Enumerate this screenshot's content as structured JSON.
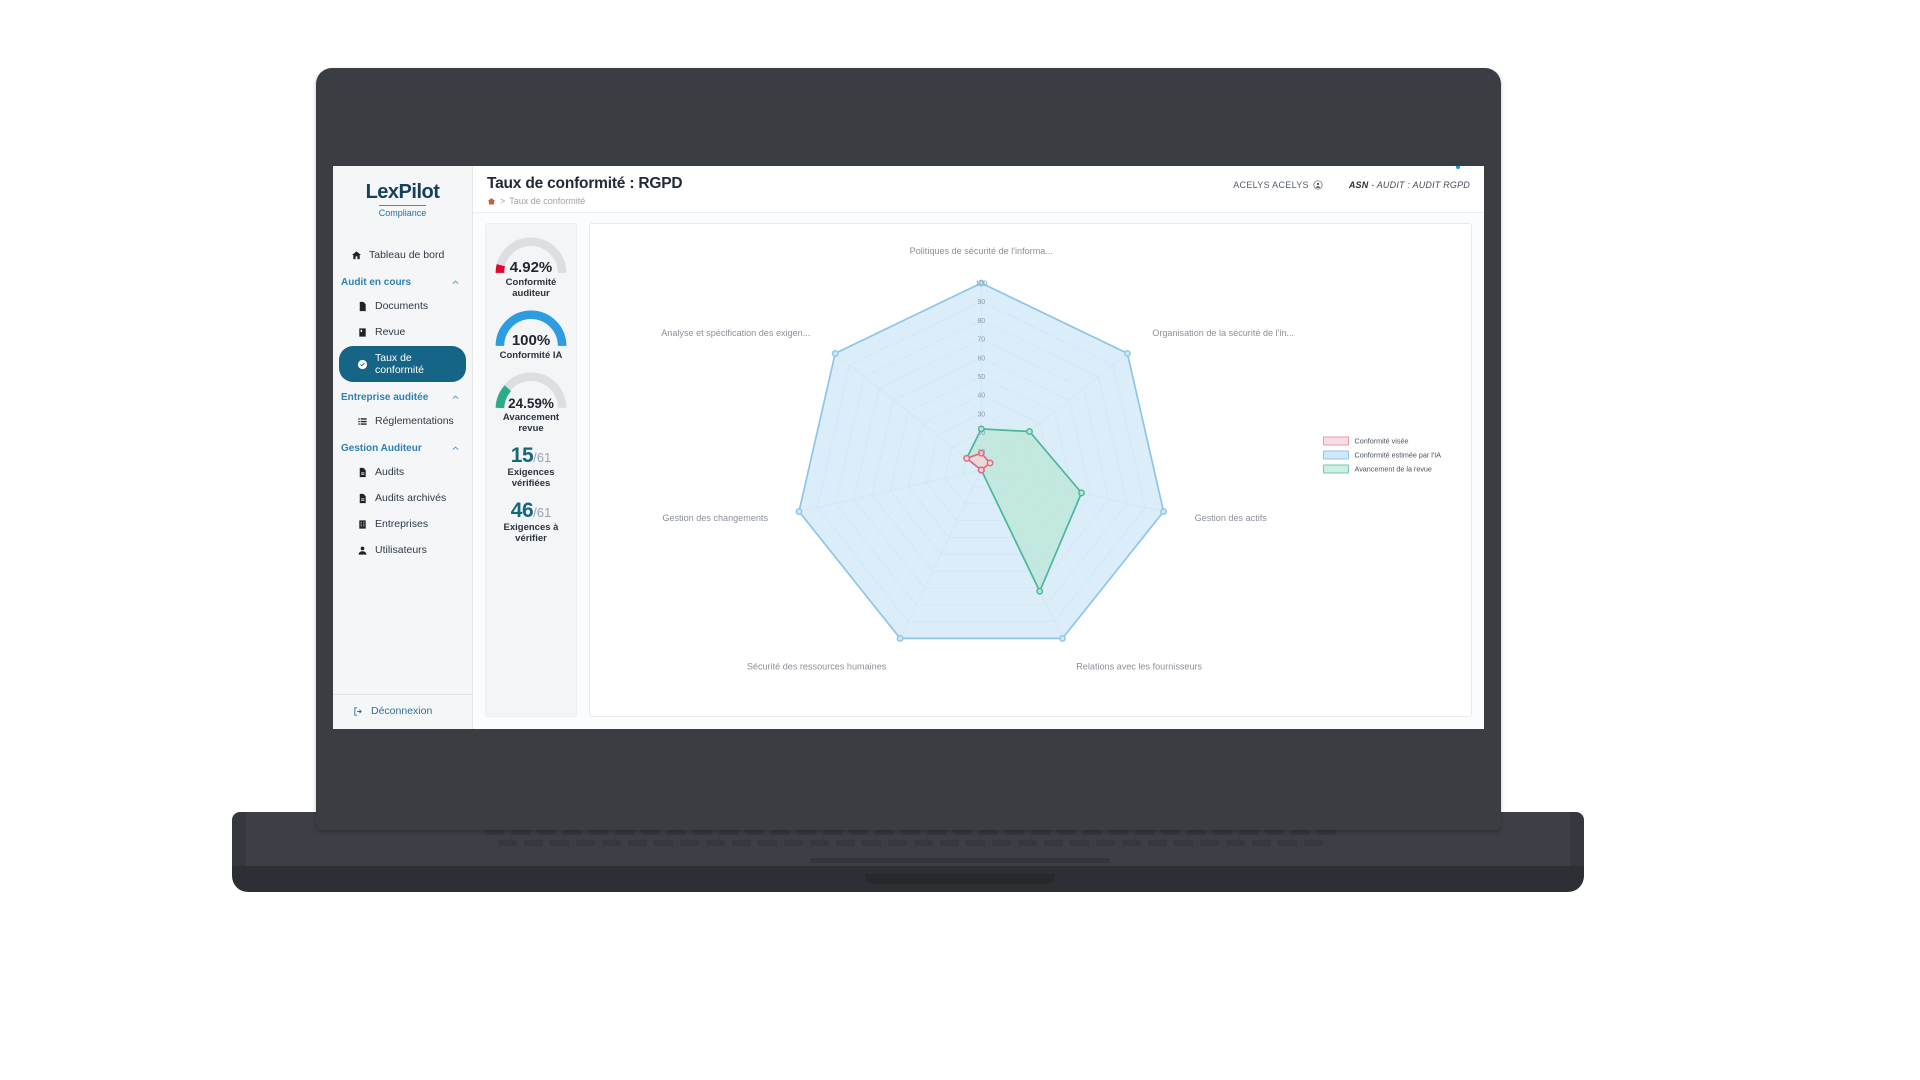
{
  "brand": {
    "name": "LexPilot",
    "subtitle": "Compliance"
  },
  "sidebar": {
    "items": [
      {
        "label": "Tableau de bord",
        "icon": "home-icon",
        "type": "item"
      },
      {
        "label": "Audit en cours",
        "icon": "chevron-up-icon",
        "type": "group"
      },
      {
        "label": "Documents",
        "icon": "document-icon",
        "type": "sub"
      },
      {
        "label": "Revue",
        "icon": "book-icon",
        "type": "sub"
      },
      {
        "label": "Taux de conformité",
        "icon": "gauge-check-icon",
        "type": "sub",
        "active": true
      },
      {
        "label": "Entreprise auditée",
        "icon": "chevron-up-icon",
        "type": "group"
      },
      {
        "label": "Réglementations",
        "icon": "list-icon",
        "type": "sub"
      },
      {
        "label": "Gestion Auditeur",
        "icon": "chevron-up-icon",
        "type": "group"
      },
      {
        "label": "Audits",
        "icon": "file-icon",
        "type": "sub"
      },
      {
        "label": "Audits archivés",
        "icon": "file-icon",
        "type": "sub"
      },
      {
        "label": "Entreprises",
        "icon": "building-icon",
        "type": "sub"
      },
      {
        "label": "Utilisateurs",
        "icon": "user-icon",
        "type": "sub"
      }
    ],
    "logout": {
      "label": "Déconnexion",
      "icon": "logout-icon"
    }
  },
  "header": {
    "title": "Taux de conformité : RGPD",
    "breadcrumb_home_icon": "home-icon",
    "breadcrumb_separator": ">",
    "breadcrumb_current": "Taux de conformité",
    "user_name": "ACELYS ACELYS",
    "user_icon": "user-circle-icon",
    "audit_code": "ASN",
    "audit_label": "- AUDIT : AUDIT RGPD"
  },
  "kpi": {
    "gauges": [
      {
        "value": "4.92%",
        "label": "Conformité auditeur",
        "percent": 4.92,
        "color": "#e4032e",
        "track": "#dcdfe2"
      },
      {
        "value": "100%",
        "label": "Conformité IA",
        "percent": 100,
        "color": "#2e9ce0",
        "track": "#dcdfe2"
      },
      {
        "value": "24.59%",
        "label": "Avancement revue",
        "percent": 24.59,
        "color": "#2bab8a",
        "track": "#dcdfe2"
      }
    ],
    "counters": [
      {
        "num": "15",
        "den": "/61",
        "label": "Exigences vérifiées"
      },
      {
        "num": "46",
        "den": "/61",
        "label": "Exigences à vérifier"
      }
    ]
  },
  "chart_data": {
    "type": "radar",
    "title": "",
    "categories": [
      "Politiques de sécurité de l'informa...",
      "Organisation de la sécurité de l'in...",
      "Gestion des actifs",
      "Relations avec les fournisseurs",
      "Sécurité des ressources humaines",
      "Gestion des changements",
      "Analyse et spécification des exigen..."
    ],
    "rlim": [
      0,
      100
    ],
    "rticks": [
      10,
      20,
      30,
      40,
      50,
      60,
      70,
      80,
      90,
      100
    ],
    "grid": true,
    "legend_position": "right",
    "series": [
      {
        "name": "Conformité visée",
        "color": "#e06b80",
        "fill": "#f7d3da",
        "values": [
          9,
          6,
          0,
          0,
          0,
          0,
          10
        ]
      },
      {
        "name": "Conformité estimée par l'IA",
        "color": "#8fc6e8",
        "fill": "#cfe7f7",
        "values": [
          100,
          100,
          100,
          100,
          100,
          100,
          100
        ]
      },
      {
        "name": "Avancement de la revue",
        "color": "#4cb79b",
        "fill": "#b9e6d7",
        "values": [
          22,
          33,
          55,
          72,
          0,
          0,
          10
        ]
      }
    ]
  }
}
